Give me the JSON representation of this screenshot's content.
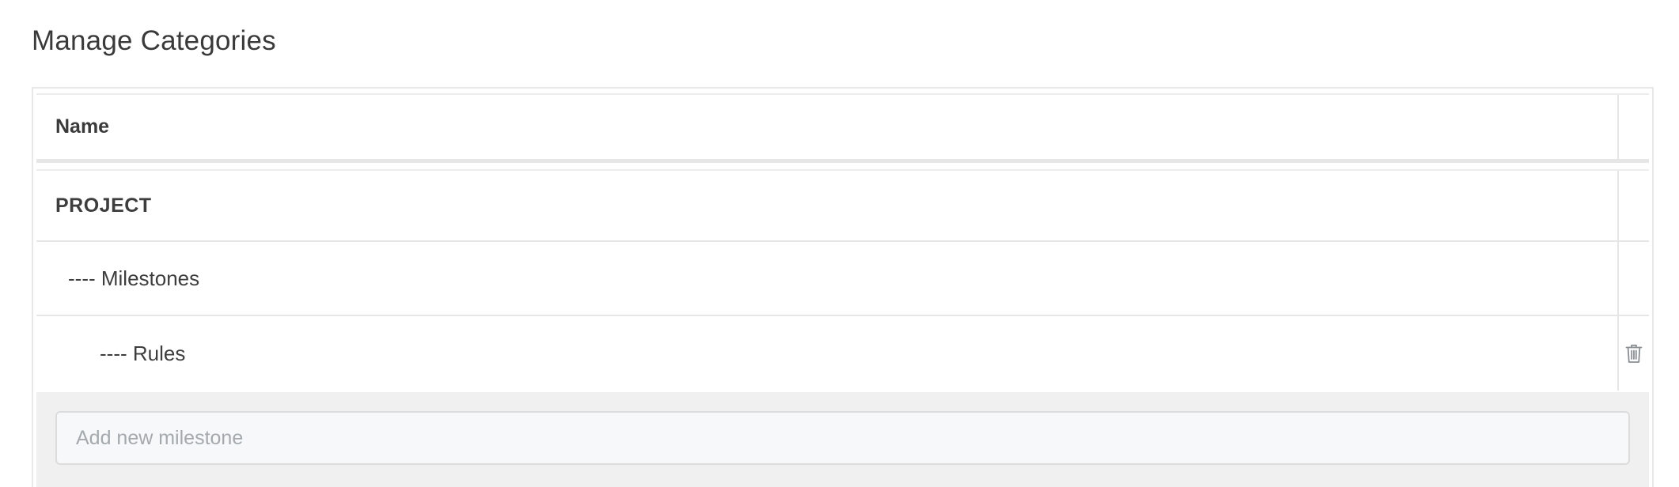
{
  "page": {
    "title": "Manage Categories"
  },
  "table": {
    "header": {
      "name_label": "Name"
    },
    "rows": [
      {
        "label": "PROJECT",
        "has_delete": false
      },
      {
        "label": "---- Milestones",
        "has_delete": false
      },
      {
        "label": "---- Rules",
        "has_delete": true,
        "delete_icon": "trash-icon"
      }
    ]
  },
  "add_milestone": {
    "value": "",
    "placeholder": "Add new milestone"
  },
  "colors": {
    "border": "#e6e6e6",
    "add_row_background": "#f0f0f0",
    "icon": "#8a8f94",
    "placeholder": "#a4a9ad"
  }
}
